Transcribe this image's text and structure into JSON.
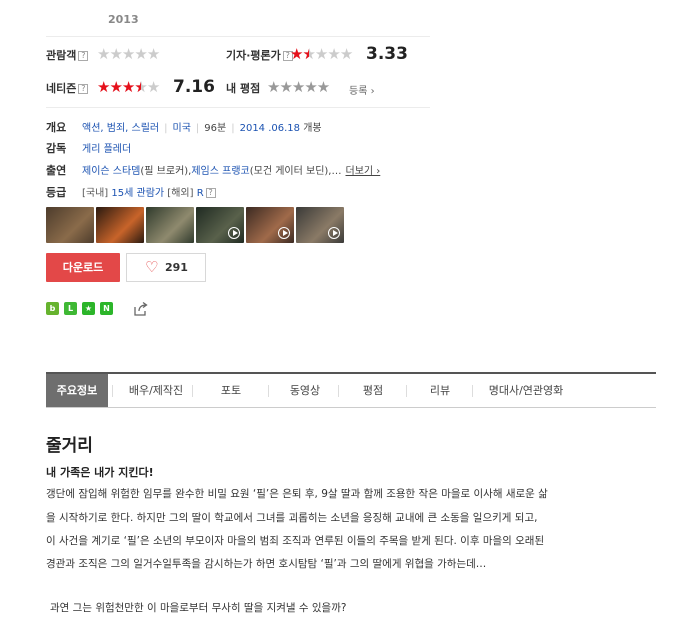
{
  "movie": {
    "year": "2013"
  },
  "ratings": {
    "audience": {
      "label": "관람객",
      "help": "?",
      "score_out_of_5": 0
    },
    "critics": {
      "label": "기자·평론가",
      "help": "?",
      "score_out_of_5": 1.5,
      "score": "3.33"
    },
    "netizen": {
      "label": "네티즌",
      "help": "?",
      "score_out_of_5": 3.5,
      "score": "7.16"
    },
    "my_rating": {
      "label": "내 평점",
      "register": "등록 ›"
    }
  },
  "info": {
    "overview": {
      "label": "개요",
      "genres": "액션, 범죄, 스릴러",
      "country": "미국",
      "runtime": "96분",
      "release_date": "2014 .06.18",
      "release_suffix": " 개봉"
    },
    "director": {
      "label": "감독",
      "name": "게리 플레더"
    },
    "cast": {
      "label": "출연",
      "actor1": "제이슨 스타뎀",
      "role1": "(필 브로커),",
      "actor2": "제임스 프랭코",
      "role2": "(모건 게이터 보딘),…",
      "more": "더보기 ›"
    },
    "grade": {
      "label": "등급",
      "domestic_tag": "[국내]",
      "domestic": "15세 관람가",
      "foreign_tag": "[해외]",
      "foreign": "R",
      "help": "?"
    }
  },
  "thumbnails": [
    {
      "name": "still-1",
      "video": false,
      "colors": [
        "#4d3c2c",
        "#8a6b4a"
      ]
    },
    {
      "name": "still-2",
      "video": false,
      "colors": [
        "#2a1a10",
        "#c8642a"
      ]
    },
    {
      "name": "still-3",
      "video": false,
      "colors": [
        "#2f3a2c",
        "#8f8a6e"
      ]
    },
    {
      "name": "video-1",
      "video": true,
      "colors": [
        "#1f2a22",
        "#59614b"
      ]
    },
    {
      "name": "video-2",
      "video": true,
      "colors": [
        "#3b2a22",
        "#a06a4a"
      ]
    },
    {
      "name": "video-3",
      "video": true,
      "colors": [
        "#3a3a38",
        "#8a7a66"
      ]
    }
  ],
  "actions": {
    "download": "다운로드",
    "like_count": "291"
  },
  "share_icons": [
    {
      "icon": "naver-blog-icon",
      "color": "#66b32e",
      "glyph": "b"
    },
    {
      "icon": "line-icon",
      "color": "#3fb834",
      "glyph": "L"
    },
    {
      "icon": "bookmark-star-icon",
      "color": "#2cb52a",
      "glyph": "★"
    },
    {
      "icon": "naver-icon",
      "color": "#2cb52a",
      "glyph": "N"
    }
  ],
  "tabs": [
    "주요정보",
    "배우/제작진",
    "포토",
    "동영상",
    "평점",
    "리뷰",
    "명대사/연관영화"
  ],
  "synopsis": {
    "heading": "줄거리",
    "tagline": "내 가족은 내가 지킨다!",
    "lines": [
      "갱단에 잠입해 위험한 임무를 완수한 비밀 요원 ‘필’은 은퇴 후, 9살 딸과 함께 조용한 작은 마을로 이사해 새로운 삶",
      "을 시작하기로 한다. 하지만 그의 딸이 학교에서 그녀를 괴롭히는 소년을 응징해 교내에 큰 소동을 일으키게 되고,",
      "이 사건을 계기로 ‘필’은 소년의 부모이자 마을의 범죄 조직과 연루된 이들의 주목을 받게 된다. 이후 마을의 오래된",
      "경관과 조직은 그의 일거수일투족을 감시하는가 하면 호시탐탐 ‘필’과 그의 딸에게 위협을 가하는데…"
    ],
    "question": "과연 그는 위험천만한 이 마을로부터 무사히 딸을 지켜낼 수 있을까?"
  }
}
